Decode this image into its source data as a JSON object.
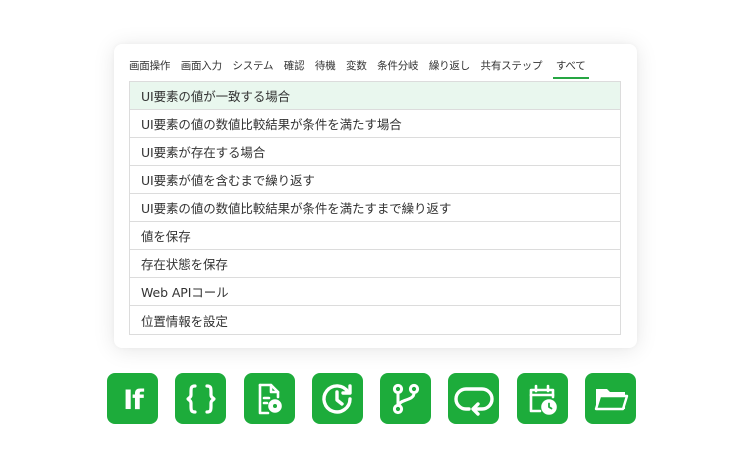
{
  "tabs": [
    "画面操作",
    "画面入力",
    "システム",
    "確認",
    "待機",
    "変数",
    "条件分岐",
    "繰り返し",
    "共有ステップ",
    "すべて"
  ],
  "active_tab": "すべて",
  "accent_color": "#26a643",
  "icon_color": "#1dac3b",
  "selected_row_bg": "#e9f7ee",
  "list_items": [
    "UI要素の値が一致する場合",
    "UI要素の値の数値比較結果が条件を満たす場合",
    "UI要素が存在する場合",
    "UI要素が値を含むまで繰り返す",
    "UI要素の値の数値比較結果が条件を満たすまで繰り返す",
    "値を保存",
    "存在状態を保存",
    "Web APIコール",
    "位置情報を設定"
  ],
  "selected_index": 0,
  "icon_buttons": [
    {
      "name": "if-icon",
      "label": "If"
    },
    {
      "name": "braces-icon",
      "label": "{}"
    },
    {
      "name": "document-settings-icon"
    },
    {
      "name": "refresh-timer-icon"
    },
    {
      "name": "branch-icon"
    },
    {
      "name": "loop-icon"
    },
    {
      "name": "calendar-clock-icon"
    },
    {
      "name": "folder-icon"
    }
  ]
}
